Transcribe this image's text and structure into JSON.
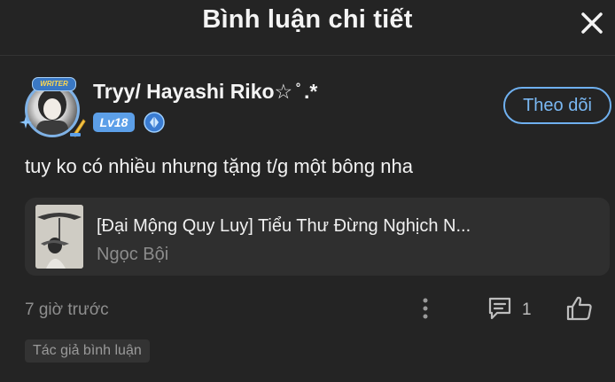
{
  "header": {
    "title": "Bình luận chi tiết",
    "close_icon": "close-icon"
  },
  "comment": {
    "avatar_badge": "WRITER",
    "username": "Tryy/ Hayashi Riko☆ ̊ .*",
    "level": "Lv18",
    "rank_icon": "diamond-rank-icon",
    "follow_label": "Theo dõi",
    "text": "tuy ko có nhiều nhưng tặng t/g một bông nha",
    "timestamp": "7 giờ trước",
    "reply_count": "1",
    "tag": "Tác giả bình luận"
  },
  "book": {
    "title": "[Đại Mộng Quy Luy] Tiểu Thư Đừng Nghịch N...",
    "author": "Ngọc Bội"
  },
  "colors": {
    "background": "#242424",
    "card": "#2f2f2f",
    "accent": "#6fb0ef",
    "level_badge": "#5c9fe8",
    "muted_text": "#8e8e8e"
  }
}
